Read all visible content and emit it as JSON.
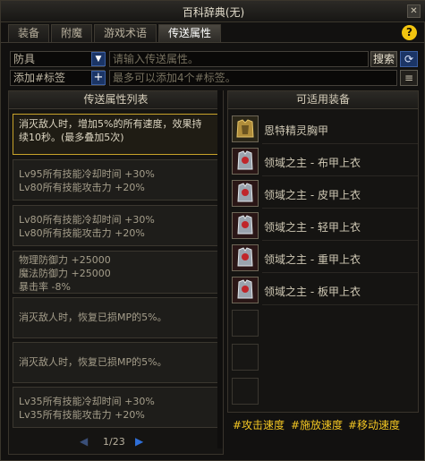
{
  "window": {
    "title": "百科辞典(无)",
    "close_label": "✕"
  },
  "tabs": [
    {
      "label": "装备",
      "active": false
    },
    {
      "label": "附魔",
      "active": false
    },
    {
      "label": "游戏术语",
      "active": false
    },
    {
      "label": "传送属性",
      "active": true
    }
  ],
  "help_label": "?",
  "filter": {
    "category_value": "防具",
    "tag_value": "添加#标签",
    "search_placeholder": "请输入传送属性。",
    "tag_placeholder": "最多可以添加4个#标签。",
    "search_label": "搜索",
    "refresh_label": "⟳",
    "menu_label": "≡",
    "add_label": "+",
    "dropdown_label": "▼"
  },
  "left_panel": {
    "title": "传送属性列表",
    "items": [
      {
        "lines": [
          "消灭敌人时，增加5%的所有速度，效果持",
          "续10秒。(最多叠加5次)"
        ],
        "selected": true
      },
      {
        "lines": [
          "Lv95所有技能冷却时间 +30%",
          "Lv80所有技能攻击力 +20%"
        ],
        "selected": false
      },
      {
        "lines": [
          "Lv80所有技能冷却时间 +30%",
          "Lv80所有技能攻击力 +20%"
        ],
        "selected": false
      },
      {
        "lines": [
          "物理防御力 +25000",
          "魔法防御力 +25000",
          "暴击率 -8%"
        ],
        "selected": false
      },
      {
        "lines": [
          "消灭敌人时，恢复已损MP的5%。"
        ],
        "selected": false
      },
      {
        "lines": [
          "消灭敌人时，恢复已损MP的5%。"
        ],
        "selected": false
      },
      {
        "lines": [
          "Lv35所有技能冷却时间 +30%",
          "Lv35所有技能攻击力 +20%"
        ],
        "selected": false
      }
    ],
    "pager": {
      "prev": "◀",
      "text": "1/23",
      "next": "▶"
    }
  },
  "right_panel": {
    "title": "可适用装备",
    "equipment": [
      {
        "name": "恩特精灵胸甲",
        "icon": "chest-armor-icon"
      },
      {
        "name": "领域之主 - 布甲上衣",
        "icon": "cloth-top-icon"
      },
      {
        "name": "领域之主 - 皮甲上衣",
        "icon": "leather-top-icon"
      },
      {
        "name": "领域之主 - 轻甲上衣",
        "icon": "light-top-icon"
      },
      {
        "name": "领域之主 - 重甲上衣",
        "icon": "heavy-top-icon"
      },
      {
        "name": "领域之主 - 板甲上衣",
        "icon": "plate-top-icon"
      }
    ],
    "hashtags": [
      "#攻击速度",
      "#施放速度",
      "#移动速度"
    ]
  },
  "colors": {
    "accent_gold": "#f3c623",
    "selected_border": "#c8a32a",
    "button_blue": "#1b3566"
  }
}
